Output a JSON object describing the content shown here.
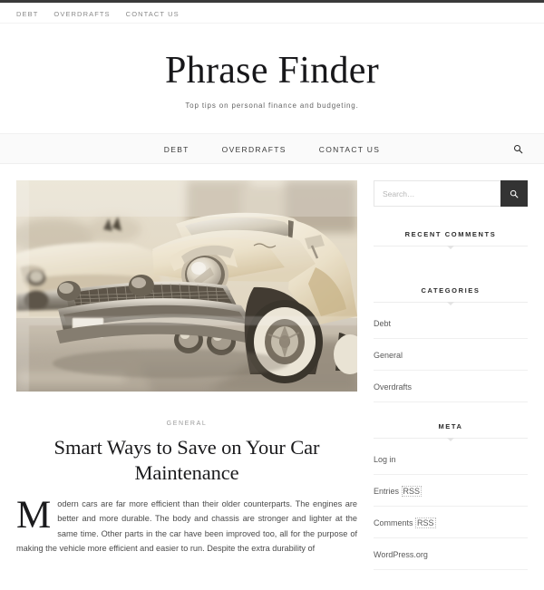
{
  "topbar": {
    "items": [
      {
        "label": "DEBT"
      },
      {
        "label": "OVERDRAFTS"
      },
      {
        "label": "CONTACT US"
      }
    ]
  },
  "branding": {
    "title": "Phrase Finder",
    "description": "Top tips on personal finance and budgeting."
  },
  "mainnav": {
    "items": [
      {
        "label": "DEBT"
      },
      {
        "label": "OVERDRAFTS"
      },
      {
        "label": "CONTACT US"
      }
    ],
    "search_icon": "search-icon"
  },
  "post": {
    "featured_image_alt": "Vintage cream 1950s Cadillac car in motion blur",
    "category": "GENERAL",
    "title": "Smart Ways to Save on Your Car Maintenance",
    "body": "Modern cars are far more efficient than their older counterparts. The engines are better and more durable. The body and chassis are stronger and lighter at the same time. Other parts in the car have been improved too, all for the purpose of making the vehicle more efficient and easier to run. Despite the extra durability of"
  },
  "sidebar": {
    "search": {
      "placeholder": "Search…",
      "value": "",
      "button_icon": "search-icon",
      "button_color": "#333333"
    },
    "widgets": [
      {
        "title": "RECENT COMMENTS",
        "items": []
      },
      {
        "title": "CATEGORIES",
        "items": [
          {
            "label": "Debt"
          },
          {
            "label": "General"
          },
          {
            "label": "Overdrafts"
          }
        ]
      },
      {
        "title": "META",
        "items": [
          {
            "label": "Log in"
          },
          {
            "label": "Entries ",
            "abbr": "RSS"
          },
          {
            "label": "Comments ",
            "abbr": "RSS"
          },
          {
            "label": "WordPress.org"
          }
        ]
      }
    ]
  }
}
